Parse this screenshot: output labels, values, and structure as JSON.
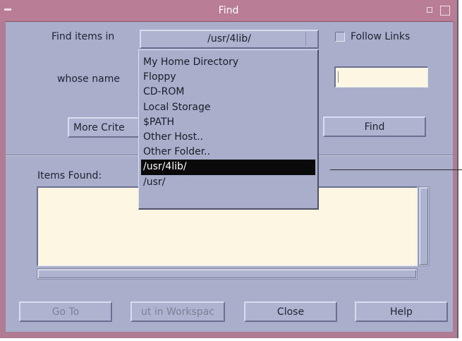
{
  "window": {
    "title": "Find"
  },
  "find_items_in": {
    "label": "Find items in",
    "selected": "/usr/4lib/"
  },
  "follow_links": {
    "label": "Follow Links",
    "checked": false
  },
  "whose_name": {
    "label": "whose name",
    "value": ""
  },
  "more_criteria": {
    "label": "More Crite"
  },
  "find_button": {
    "label": "Find"
  },
  "items_found": {
    "label": "Items Found:"
  },
  "dropdown": {
    "options": [
      "My Home Directory",
      "Floppy",
      "CD-ROM",
      "Local Storage",
      "$PATH",
      "Other Host..",
      "Other Folder..",
      "/usr/4lib/",
      "/usr/"
    ],
    "selected_index": 7
  },
  "buttons": {
    "goto": "Go To",
    "put_in_workspace": "ut in Workspac",
    "close": "Close",
    "help": "Help"
  }
}
